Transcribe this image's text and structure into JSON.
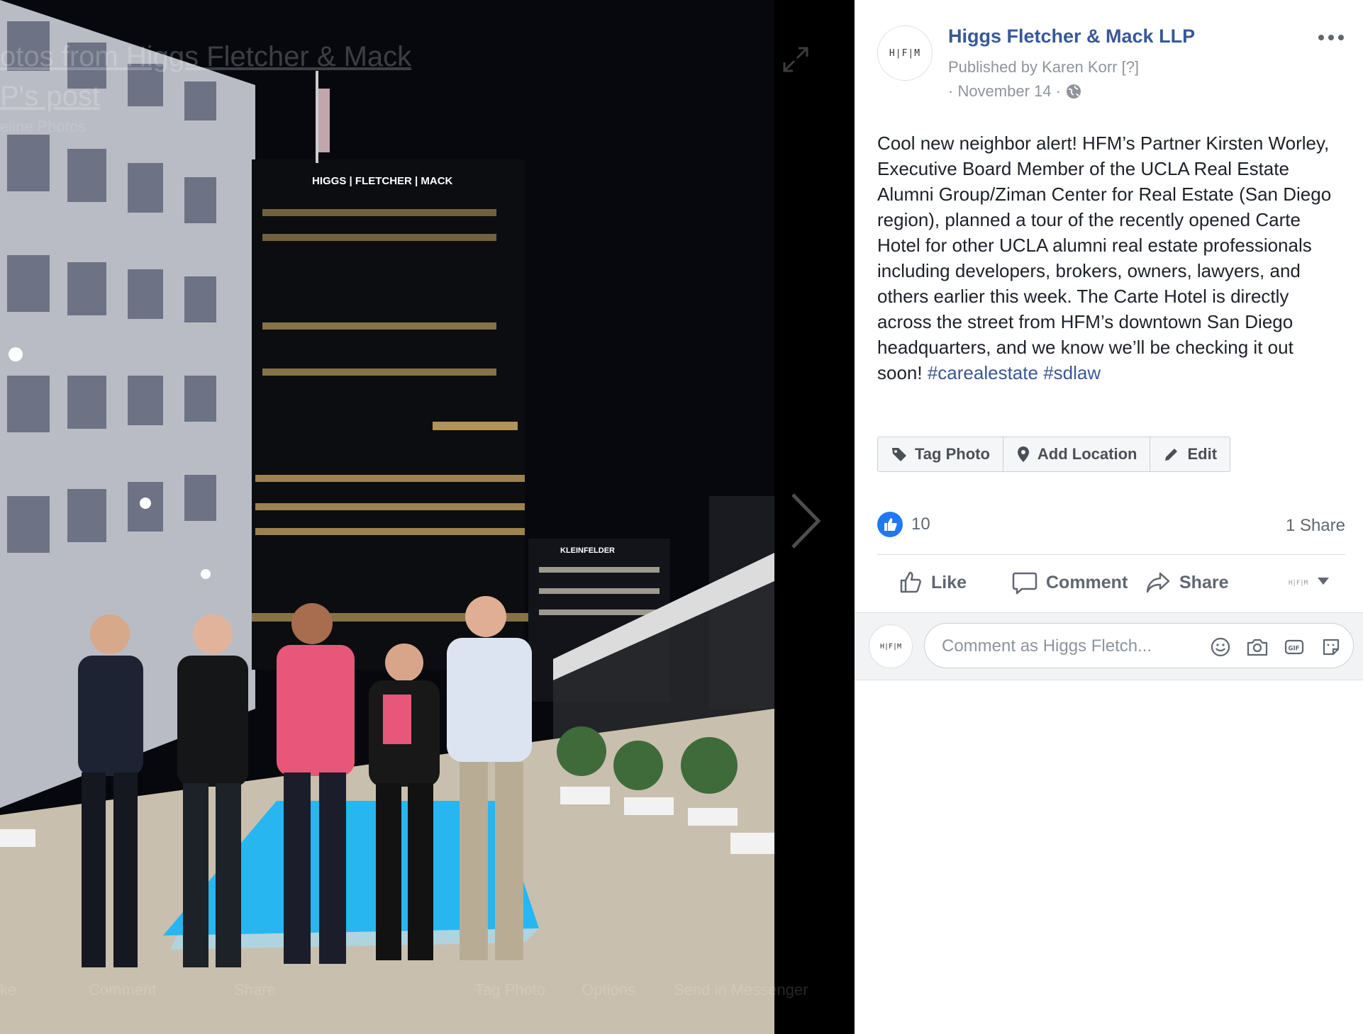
{
  "stage": {
    "overlay_title": "otos from Higgs Fletcher & Mack P's post",
    "overlay_subtitle": "eline Photos",
    "building_sign": "HIGGS | FLETCHER | MACK",
    "building_sign_2": "KLEINFELDER",
    "footer": {
      "like": "ke",
      "comment": "Comment",
      "share": "Share",
      "tag_photo": "Tag Photo",
      "options": "Options",
      "send": "Send in Messenger"
    }
  },
  "post": {
    "avatar_text": "H|F|M",
    "page_name": "Higgs Fletcher & Mack LLP",
    "published_by": "Published by Karen Korr [?]",
    "date": "· November 14 ·",
    "body": "Cool new neighbor alert! HFM’s Partner Kirsten Worley, Executive Board Member of the UCLA Real Estate Alumni Group/Ziman Center for Real Estate (San Diego region), planned a tour of the recently opened Carte Hotel for other UCLA alumni real estate professionals including developers, brokers, owners, lawyers, and others earlier this week. The Carte Hotel is directly across the street from HFM’s downtown San Diego headquarters, and we know we’ll be checking it out soon!",
    "hashtag_1": "#carealestate",
    "hashtag_2": "#sdlaw"
  },
  "actions": {
    "tag_photo": "Tag Photo",
    "add_location": "Add Location",
    "edit": "Edit"
  },
  "reactions": {
    "like_count": "10",
    "share_count": "1 Share"
  },
  "ufi": {
    "like": "Like",
    "comment": "Comment",
    "share": "Share"
  },
  "composer": {
    "avatar_text": "H|F|M",
    "placeholder": "Comment as Higgs Fletch..."
  },
  "colors": {
    "brand_blue": "#385898",
    "like_blue": "#2078f4",
    "muted": "#90949c"
  }
}
